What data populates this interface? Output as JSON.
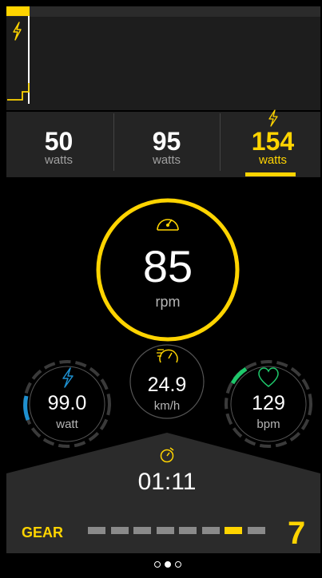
{
  "colors": {
    "accent": "#ffd400",
    "power": "#1e90d0",
    "heart": "#1ec86b"
  },
  "chart": {
    "icon": "lightning-icon"
  },
  "power_options": [
    {
      "value": "50",
      "unit": "watts"
    },
    {
      "value": "95",
      "unit": "watts"
    },
    {
      "value": "154",
      "unit": "watts",
      "selected": true,
      "icon": "lightning-icon"
    }
  ],
  "cadence": {
    "value": "85",
    "unit": "rpm",
    "icon": "speedometer-icon"
  },
  "power": {
    "value": "99.0",
    "unit": "watt",
    "icon": "lightning-icon"
  },
  "speed": {
    "value": "24.9",
    "unit": "km/h",
    "icon": "speed-gauge-icon"
  },
  "heart_rate": {
    "value": "129",
    "unit": "bpm",
    "icon": "heart-icon"
  },
  "timer": {
    "value": "01:11",
    "icon": "stopwatch-icon"
  },
  "gear": {
    "label": "GEAR",
    "value": "7",
    "segments_total": 8,
    "active_segment": 7
  },
  "pager": {
    "count": 3,
    "active": 2
  }
}
